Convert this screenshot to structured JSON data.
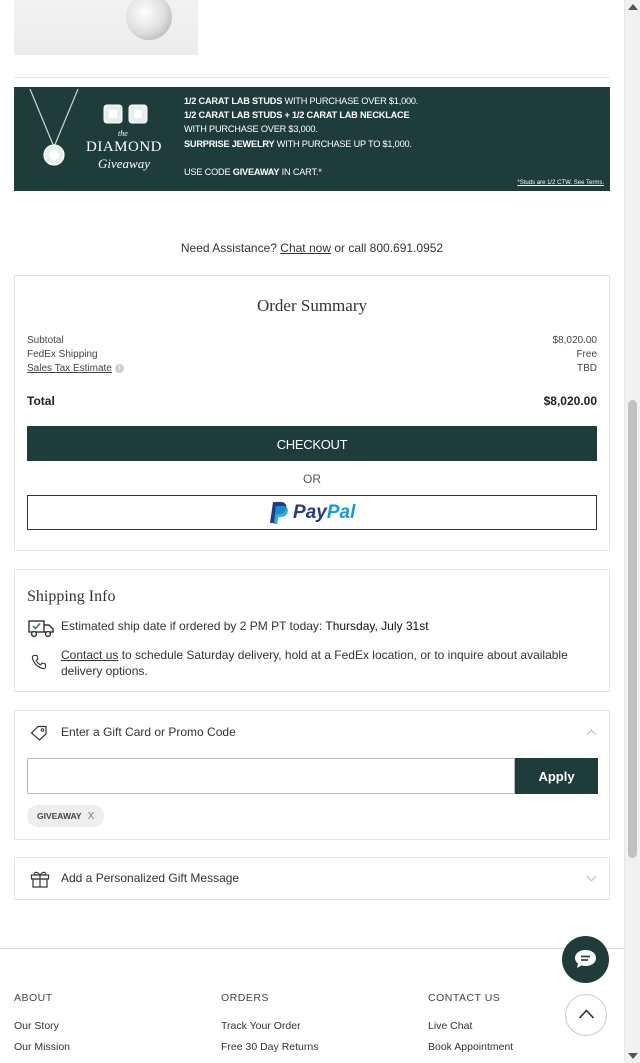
{
  "banner": {
    "logo_the": "the",
    "logo_word": "DIAMOND",
    "logo_giveaway": "Giveaway",
    "line1_bold": "1/2 CARAT LAB STUDS",
    "line1_rest": " WITH PURCHASE OVER $1,000.",
    "line2_bold": "1/2 CARAT LAB STUDS + 1/2 CARAT LAB NECKLACE",
    "line3": "WITH PURCHASE OVER $3,000.",
    "line4_bold": "SURPRISE JEWELRY",
    "line4_rest": " WITH PURCHASE UP TO $1,000.",
    "line5_pre": "USE CODE ",
    "line5_bold": "GIVEAWAY",
    "line5_post": " IN CART.*",
    "terms": "*Studs are 1/2 CTW. See Terms."
  },
  "assistance": {
    "prefix": "Need Assistance? ",
    "chat_link": "Chat now",
    "suffix": " or call 800.691.0952"
  },
  "order_summary": {
    "title": "Order Summary",
    "subtotal_label": "Subtotal",
    "subtotal_value": "$8,020.00",
    "shipping_label": "FedEx Shipping",
    "shipping_value": "Free",
    "tax_label": "Sales Tax Estimate",
    "tax_value": "TBD",
    "total_label": "Total",
    "total_value": "$8,020.00",
    "checkout_label": "CHECKOUT",
    "or_label": "OR",
    "paypal_pay": "Pay",
    "paypal_pal": "Pal"
  },
  "shipping_info": {
    "title": "Shipping Info",
    "estimate_text": "Estimated ship date if ordered by 2 PM PT today: ",
    "estimate_date": "Thursday, July 31st",
    "contact_link": "Contact us",
    "contact_line1": " to schedule Saturday delivery, hold at a FedEx location, or to inquire about available",
    "contact_line2": "delivery options."
  },
  "promo": {
    "heading": "Enter a Gift Card or Promo Code",
    "input_value": "",
    "apply_label": "Apply",
    "applied_code": "GIVEAWAY",
    "remove_label": "X"
  },
  "gift_message": {
    "heading": "Add a Personalized Gift Message"
  },
  "footer": {
    "about": {
      "heading": "ABOUT",
      "links": [
        "Our Story",
        "Our Mission"
      ]
    },
    "orders": {
      "heading": "ORDERS",
      "links": [
        "Track Your Order",
        "Free 30 Day Returns"
      ]
    },
    "contact": {
      "heading": "CONTACT US",
      "links": [
        "Live Chat",
        "Book Appointment"
      ]
    }
  },
  "colors": {
    "brand_green": "#1e3d3a",
    "paypal_dark": "#253b80",
    "paypal_light": "#179bd7"
  },
  "icons": {
    "ship_truck": "truck-icon",
    "phone": "phone-icon",
    "tag": "tag-icon",
    "gift": "gift-icon",
    "chat": "chat-bubble-icon",
    "back_to_top": "chevron-up-icon"
  }
}
